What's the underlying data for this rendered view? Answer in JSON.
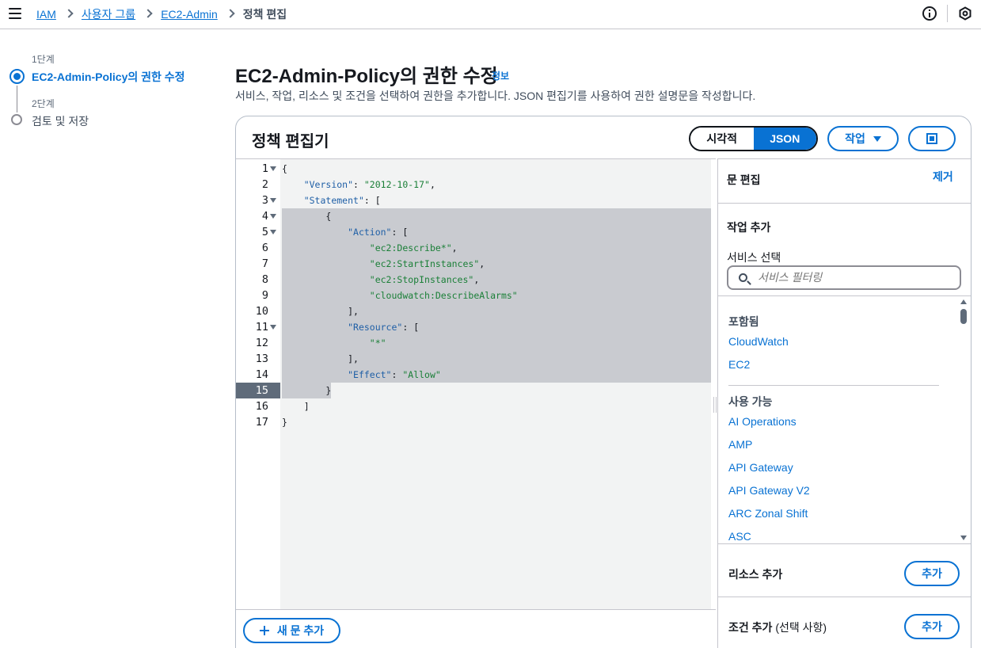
{
  "breadcrumb": {
    "items": [
      "IAM",
      "사용자 그룹",
      "EC2-Admin"
    ],
    "current": "정책 편집"
  },
  "icons": {
    "menu": "hamburger-icon",
    "info": "info-circle-icon",
    "settings": "hexagon-icon"
  },
  "steps": {
    "step1_label": "1단계",
    "step1_title": "EC2-Admin-Policy의 권한 수정",
    "step2_label": "2단계",
    "step2_title": "검토 및 저장"
  },
  "page": {
    "title": "EC2-Admin-Policy의 권한 수정",
    "info_link": "정보",
    "description": "서비스, 작업, 리소스 및 조건을 선택하여 권한을 추가합니다. JSON 편집기를 사용하여 권한 설명문을 작성합니다."
  },
  "editor": {
    "title": "정책 편집기",
    "mode_visual": "시각적",
    "mode_json": "JSON",
    "action_label": "작업",
    "add_statement": "새 문 추가",
    "active_line": "15",
    "line_numbers": [
      "1",
      "2",
      "3",
      "4",
      "5",
      "6",
      "7",
      "8",
      "9",
      "10",
      "11",
      "12",
      "13",
      "14",
      "15",
      "16",
      "17"
    ]
  },
  "code": {
    "l1": "{",
    "l2_key": "\"Version\"",
    "l2_rest": ": ",
    "l2_val": "\"2012-10-17\"",
    "l2_end": ",",
    "l3_key": "\"Statement\"",
    "l3_rest": ": [",
    "l4": "{",
    "l5_key": "\"Action\"",
    "l5_rest": ": [",
    "l6": "\"ec2:Describe*\"",
    "l7": "\"ec2:StartInstances\"",
    "l8": "\"ec2:StopInstances\"",
    "l9": "\"cloudwatch:DescribeAlarms\"",
    "l10": "],",
    "l11_key": "\"Resource\"",
    "l11_rest": ": [",
    "l12": "\"*\"",
    "l13": "],",
    "l14_key": "\"Effect\"",
    "l14_rest": ": ",
    "l14_val": "\"Allow\"",
    "l15": "}",
    "l16": "]",
    "l17": "}",
    "comma": ","
  },
  "right_panel": {
    "title": "문 편집",
    "remove": "제거",
    "add_action": "작업 추가",
    "service_select": "서비스 선택",
    "search_placeholder": "서비스 필터링",
    "included_label": "포함됨",
    "included": [
      "CloudWatch",
      "EC2"
    ],
    "available_label": "사용 가능",
    "available": [
      "AI Operations",
      "AMP",
      "API Gateway",
      "API Gateway V2",
      "ARC Zonal Shift",
      "ASC"
    ],
    "add_resource": "리소스 추가",
    "add_condition": "조건 추가",
    "condition_optional": "(선택 사항)",
    "add_button": "추가"
  }
}
